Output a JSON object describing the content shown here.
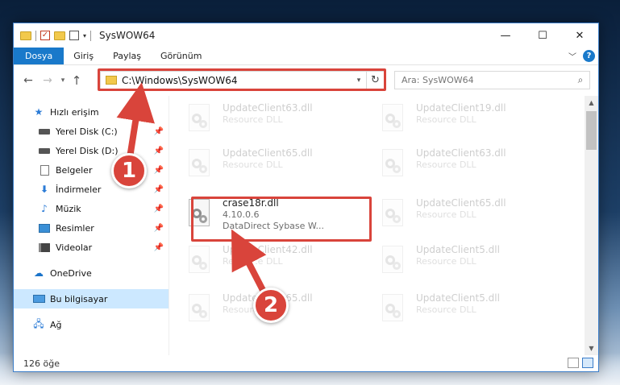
{
  "window": {
    "title": "SysWOW64",
    "controls": {
      "minimize": "—",
      "maximize": "☐",
      "close": "✕"
    }
  },
  "ribbon": {
    "tabs": [
      "Dosya",
      "Giriş",
      "Paylaş",
      "Görünüm"
    ],
    "help": "?"
  },
  "address": {
    "path": "C:\\Windows\\SysWOW64",
    "search_placeholder": "Ara: SysWOW64"
  },
  "sidebar": {
    "quick_access": "Hızlı erişim",
    "items": [
      {
        "label": "Yerel Disk (C:)",
        "icon": "disk-icon"
      },
      {
        "label": "Yerel Disk (D:)",
        "icon": "disk-icon"
      },
      {
        "label": "Belgeler",
        "icon": "documents-icon"
      },
      {
        "label": "İndirmeler",
        "icon": "downloads-icon"
      },
      {
        "label": "Müzik",
        "icon": "music-icon"
      },
      {
        "label": "Resimler",
        "icon": "pictures-icon"
      },
      {
        "label": "Videolar",
        "icon": "videos-icon"
      }
    ],
    "onedrive": "OneDrive",
    "this_pc": "Bu bilgisayar",
    "network": "Ağ"
  },
  "files": {
    "left_column": [
      {
        "name": "UpdateClient63.dll",
        "sub": "Resource DLL",
        "faded": true
      },
      {
        "name": "UpdateClient65.dll",
        "sub": "Resource DLL",
        "faded": true
      },
      {
        "name": "crase18r.dll",
        "version": "4.10.0.6",
        "sub": "DataDirect Sybase W...",
        "faded": false
      },
      {
        "name": "UpdateClient42.dll",
        "sub": "Resource DLL",
        "faded": true
      },
      {
        "name": "UpdateClient65.dll",
        "sub": "Resource DLL",
        "faded": true
      }
    ],
    "right_column": [
      {
        "name": "UpdateClient19.dll",
        "sub": "Resource DLL",
        "faded": true
      },
      {
        "name": "UpdateClient63.dll",
        "sub": "Resource DLL",
        "faded": true
      },
      {
        "name": "UpdateClient65.dll",
        "sub": "Resource DLL",
        "faded": true
      },
      {
        "name": "UpdateClient5.dll",
        "sub": "Resource DLL",
        "faded": true
      },
      {
        "name": "UpdateClient5.dll",
        "sub": "Resource DLL",
        "faded": true
      }
    ]
  },
  "status": {
    "count": "126 öğe"
  },
  "callouts": {
    "one": "1",
    "two": "2"
  },
  "colors": {
    "accent": "#1979ca",
    "highlight": "#d9443b",
    "selection": "#cce8ff"
  }
}
